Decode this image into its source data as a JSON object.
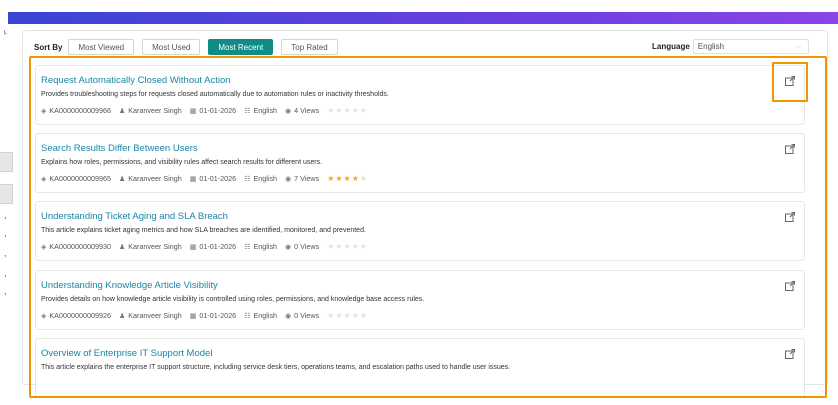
{
  "sort": {
    "label": "Sort By",
    "options": [
      {
        "label": "Most Viewed",
        "active": false
      },
      {
        "label": "Most Used",
        "active": false
      },
      {
        "label": "Most Recent",
        "active": true
      },
      {
        "label": "Top Rated",
        "active": false
      }
    ]
  },
  "language": {
    "label": "Language",
    "selected": "English"
  },
  "colors": {
    "accent": "#0f8c86",
    "highlight": "#f29400",
    "title": "#1a86a6",
    "star": "#f5a623"
  },
  "articles": [
    {
      "title": "Request Automatically Closed Without Action",
      "description": "Provides troubleshooting steps for requests closed automatically due to automation rules or inactivity thresholds.",
      "id": "KA0000000009966",
      "author": "Karanveer Singh",
      "date": "01-01-2026",
      "language": "English",
      "views": "4 Views",
      "rating": 0
    },
    {
      "title": "Search Results Differ Between Users",
      "description": "Explains how roles, permissions, and visibility rules affect search results for different users.",
      "id": "KA0000000009965",
      "author": "Karanveer Singh",
      "date": "01-01-2026",
      "language": "English",
      "views": "7 Views",
      "rating": 4
    },
    {
      "title": "Understanding Ticket Aging and SLA Breach",
      "description": "This article explains ticket aging metrics and how SLA breaches are identified, monitored, and prevented.",
      "id": "KA0000000009930",
      "author": "Karanveer Singh",
      "date": "01-01-2026",
      "language": "English",
      "views": "0 Views",
      "rating": 0
    },
    {
      "title": "Understanding Knowledge Article Visibility",
      "description": "Provides details on how knowledge article visibility is controlled using roles, permissions, and knowledge base access rules.",
      "id": "KA0000000009926",
      "author": "Karanveer Singh",
      "date": "01-01-2026",
      "language": "English",
      "views": "0 Views",
      "rating": 0
    },
    {
      "title": "Overview of Enterprise IT Support Model",
      "description": "This article explains the enterprise IT support structure, including service desk tiers, operations teams, and escalation paths used to handle user issues."
    }
  ]
}
